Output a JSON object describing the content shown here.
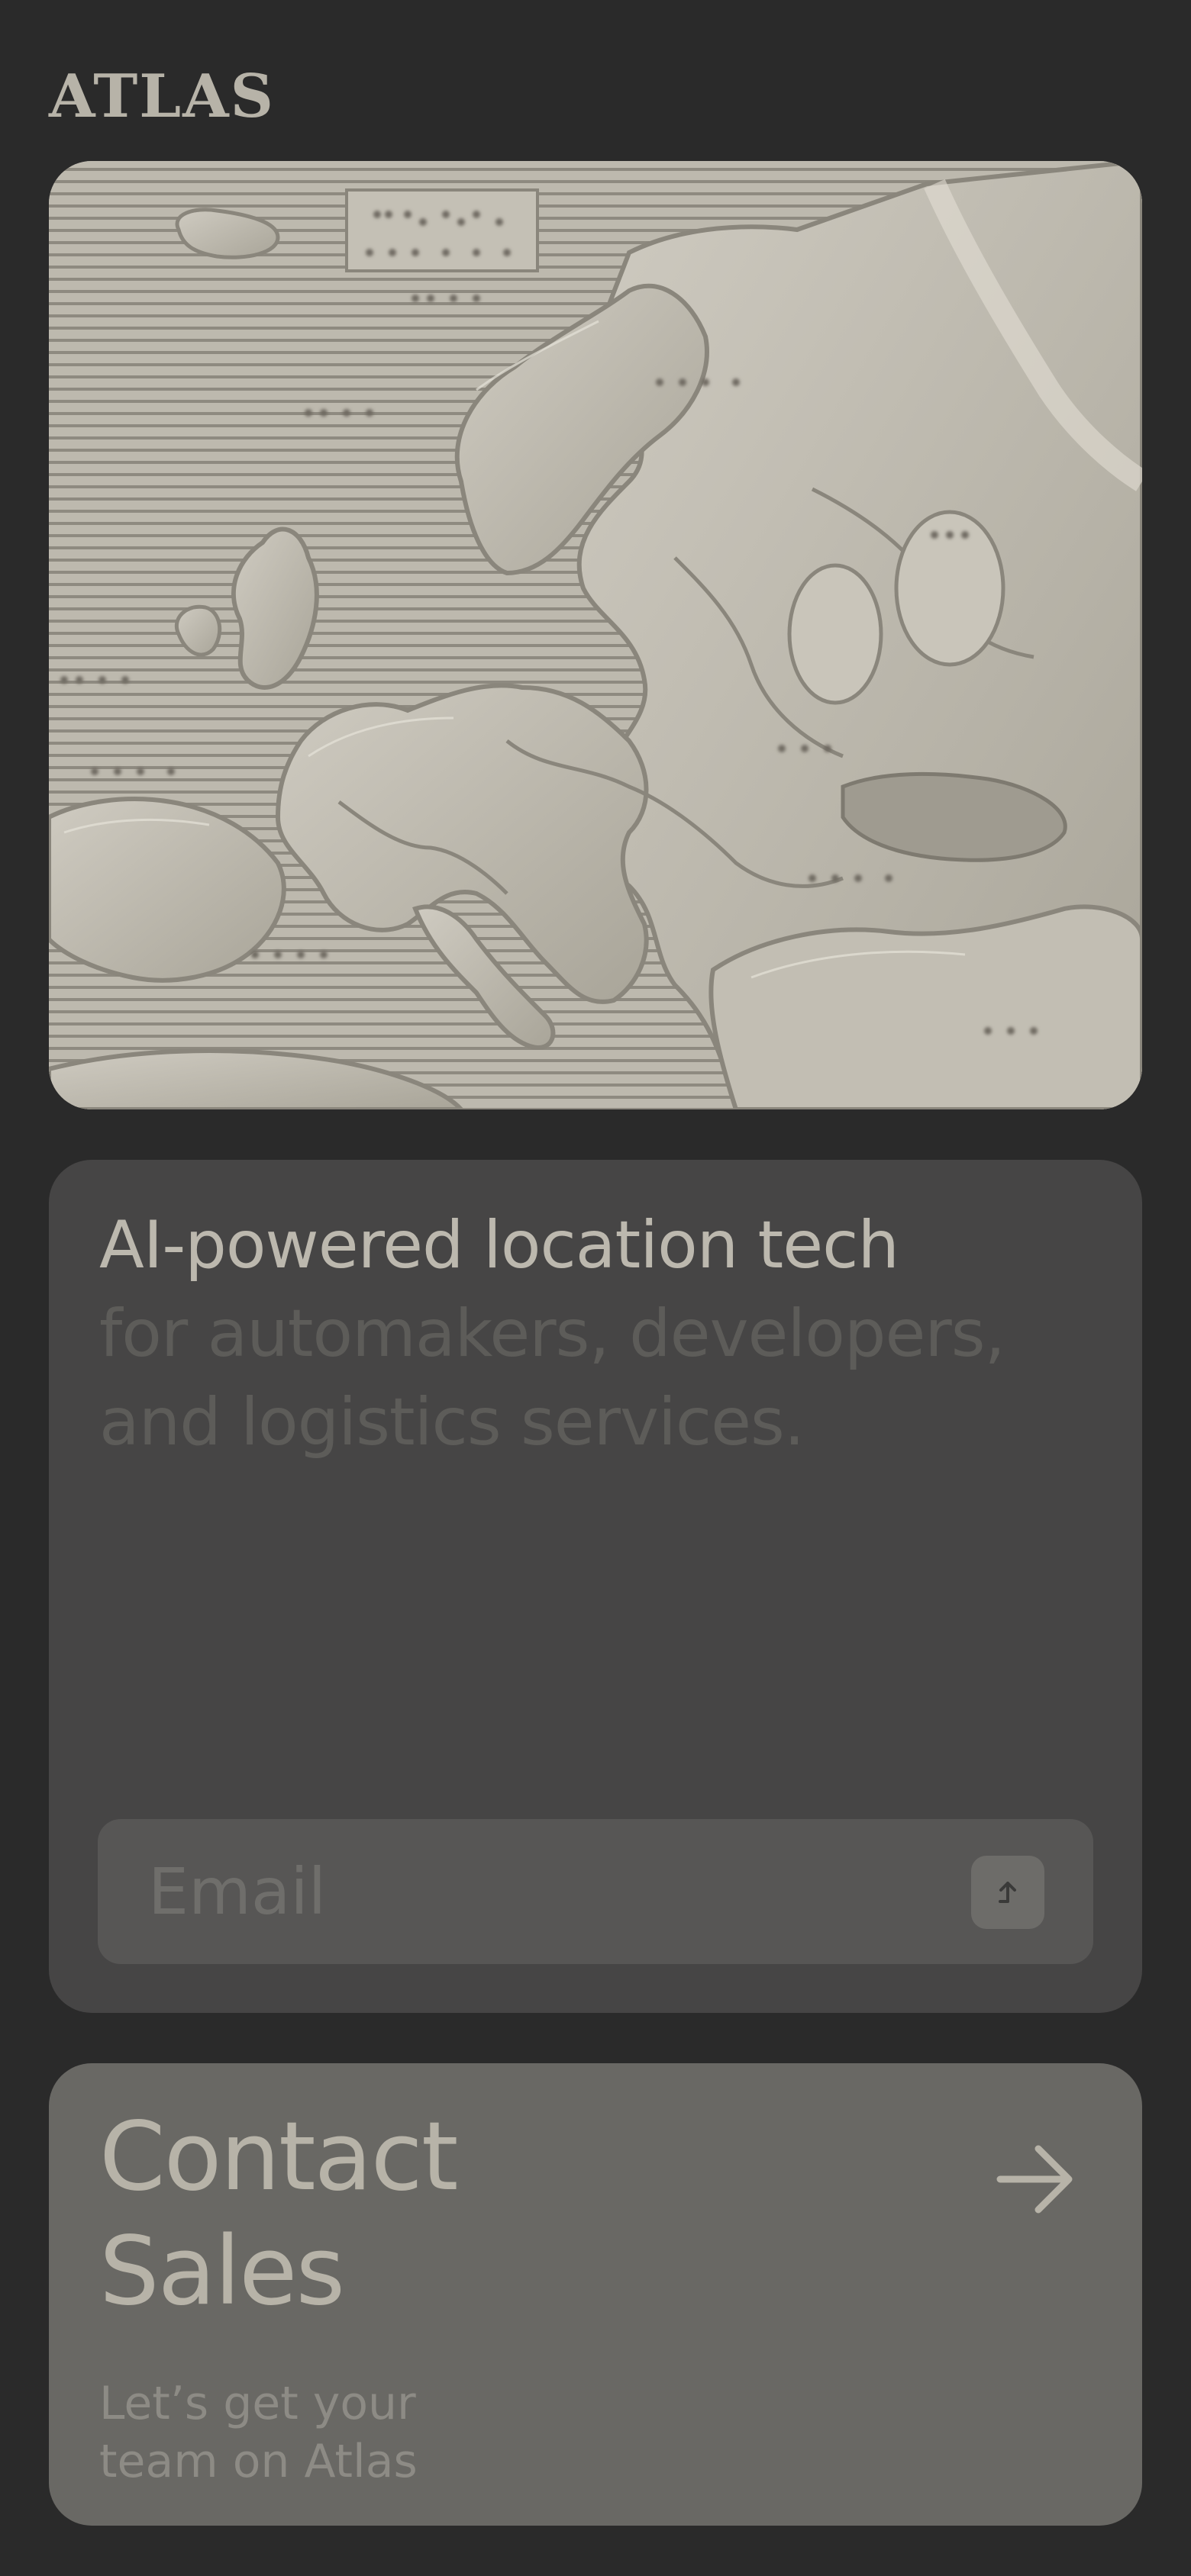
{
  "brand": {
    "logo_text": "ATLAS"
  },
  "hero": {
    "image_description": "embossed tactile relief map of Europe with braille labels",
    "image_icon": "map-of-europe-relief"
  },
  "tagline": {
    "headline": "AI-powered location tech",
    "subline": "for automakers, developers, and logistics services."
  },
  "signup": {
    "email_placeholder": "Email",
    "email_value": "",
    "submit_icon": "arrow-up-icon"
  },
  "contact": {
    "title_line1": "Contact",
    "title_line2": "Sales",
    "subtitle_line1": "Let’s get your",
    "subtitle_line2": "team on Atlas",
    "arrow_icon": "arrow-right-icon"
  },
  "colors": {
    "page_background": "#2a2a2a",
    "tagline_card": "#464545",
    "contact_card": "#696864",
    "text_primary": "#bcb8ae",
    "text_muted": "#5d5c59"
  }
}
